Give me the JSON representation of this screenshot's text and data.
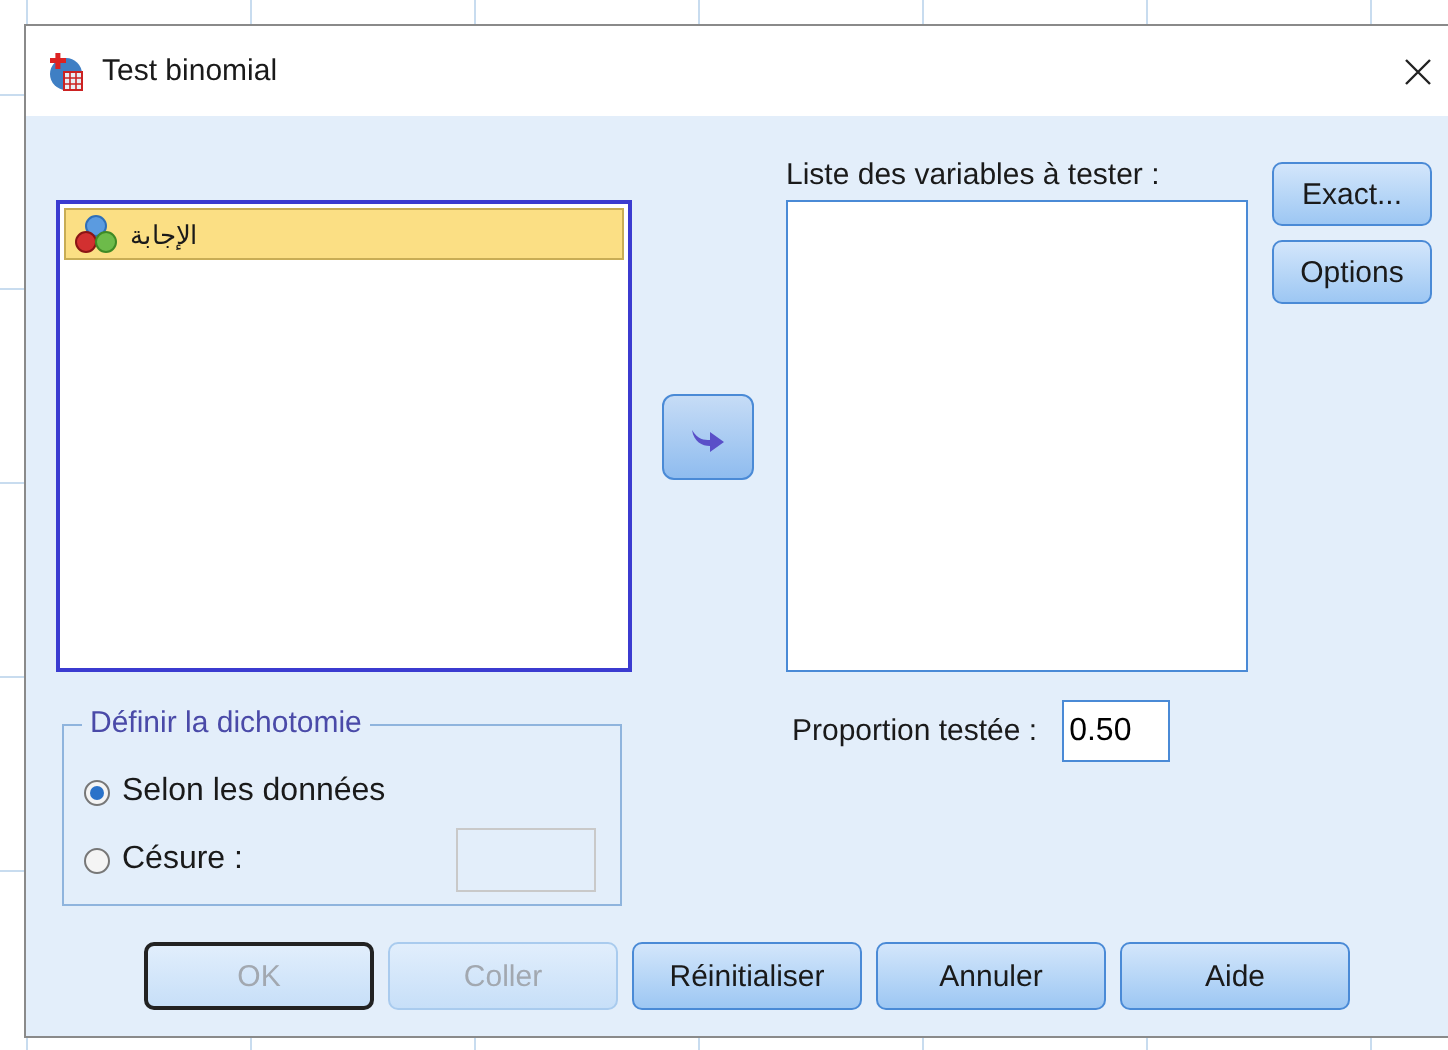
{
  "window": {
    "title": "Test binomial"
  },
  "source_list": {
    "items": [
      {
        "label": "الإجابة",
        "selected": true
      }
    ]
  },
  "test_list": {
    "label": "Liste des variables à tester :"
  },
  "side_buttons": [
    "Exact...",
    "Options"
  ],
  "dichotomy": {
    "title": "Définir la dichotomie",
    "options": [
      {
        "label": "Selon les données",
        "selected": true
      },
      {
        "label": "Césure :",
        "selected": false
      }
    ],
    "cut_field": {
      "disabled": true
    }
  },
  "proportion": {
    "label": "Proportion testée :",
    "value": "0.50"
  },
  "buttons": [
    {
      "label": "OK",
      "disabled": true,
      "default": true
    },
    {
      "label": "Coller",
      "disabled": true,
      "default": false
    },
    {
      "label": "Réinitialiser",
      "disabled": false,
      "default": false
    },
    {
      "label": "Annuler",
      "disabled": false,
      "default": false
    },
    {
      "label": "Aide",
      "disabled": false,
      "default": false
    }
  ]
}
